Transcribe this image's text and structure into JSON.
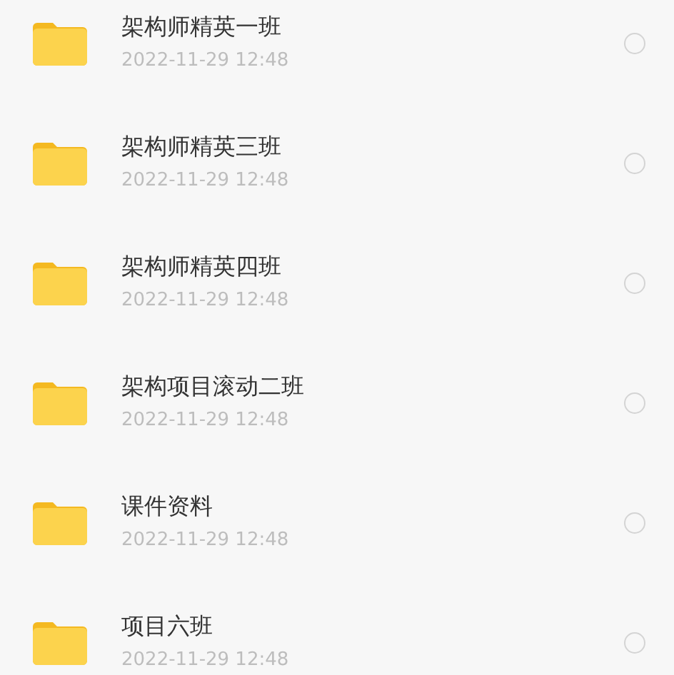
{
  "files": [
    {
      "name": "架构师精英一班",
      "time": "2022-11-29 12:48",
      "selected": false
    },
    {
      "name": "架构师精英三班",
      "time": "2022-11-29 12:48",
      "selected": false
    },
    {
      "name": "架构师精英四班",
      "time": "2022-11-29 12:48",
      "selected": false
    },
    {
      "name": "架构项目滚动二班",
      "time": "2022-11-29 12:48",
      "selected": false
    },
    {
      "name": "课件资料",
      "time": "2022-11-29 12:48",
      "selected": false
    },
    {
      "name": "项目六班",
      "time": "2022-11-29 12:48",
      "selected": false
    }
  ]
}
